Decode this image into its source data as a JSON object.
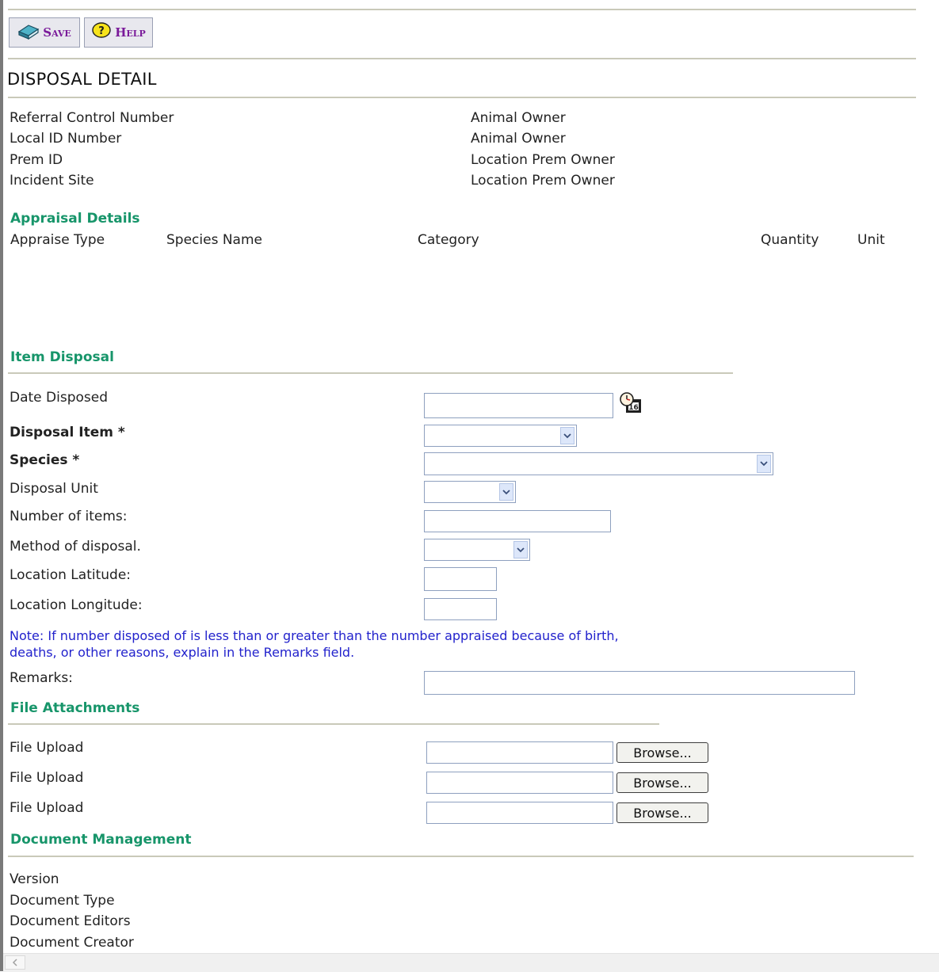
{
  "toolbar": {
    "save_label": "Save",
    "help_label": "Help"
  },
  "page": {
    "title": "DISPOSAL DETAIL"
  },
  "info": {
    "left": [
      "Referral Control Number",
      "Local ID Number",
      "Prem ID",
      "Incident Site"
    ],
    "right": [
      "Animal Owner",
      "Animal Owner",
      "Location Prem Owner",
      "Location Prem Owner"
    ]
  },
  "appraisal": {
    "heading": "Appraisal Details",
    "columns": [
      "Appraise Type",
      "Species Name",
      "Category",
      "Quantity",
      "Unit"
    ]
  },
  "item_disposal": {
    "heading": "Item Disposal",
    "date_disposed": "Date Disposed",
    "disposal_item": "Disposal Item *",
    "species": "Species *",
    "disposal_unit": "Disposal Unit",
    "number_of_items": "Number of items:",
    "method_of_disposal": "Method of disposal.",
    "latitude": "Location Latitude:",
    "longitude": "Location Longitude:",
    "note_line1": "Note: If number disposed of is less than or greater than the number appraised because of birth,",
    "note_line2": "deaths, or other reasons, explain in the Remarks field.",
    "remarks": "Remarks:"
  },
  "attachments": {
    "heading": "File Attachments",
    "upload_label": "File Upload",
    "browse_label": "Browse..."
  },
  "document_management": {
    "heading": "Document Management",
    "fields": [
      "Version",
      "Document Type",
      "Document Editors",
      "Document Creator"
    ]
  },
  "icons": {
    "save": "book-icon",
    "help": "question-icon",
    "calendar": "calendar-clock-icon",
    "dropdown": "chevron-down-icon",
    "scroll_left": "scroll-left-arrow-icon"
  },
  "colors": {
    "section_heading": "#17956a",
    "toolbar_text": "#7a1a9a",
    "note_text": "#2222cc"
  }
}
